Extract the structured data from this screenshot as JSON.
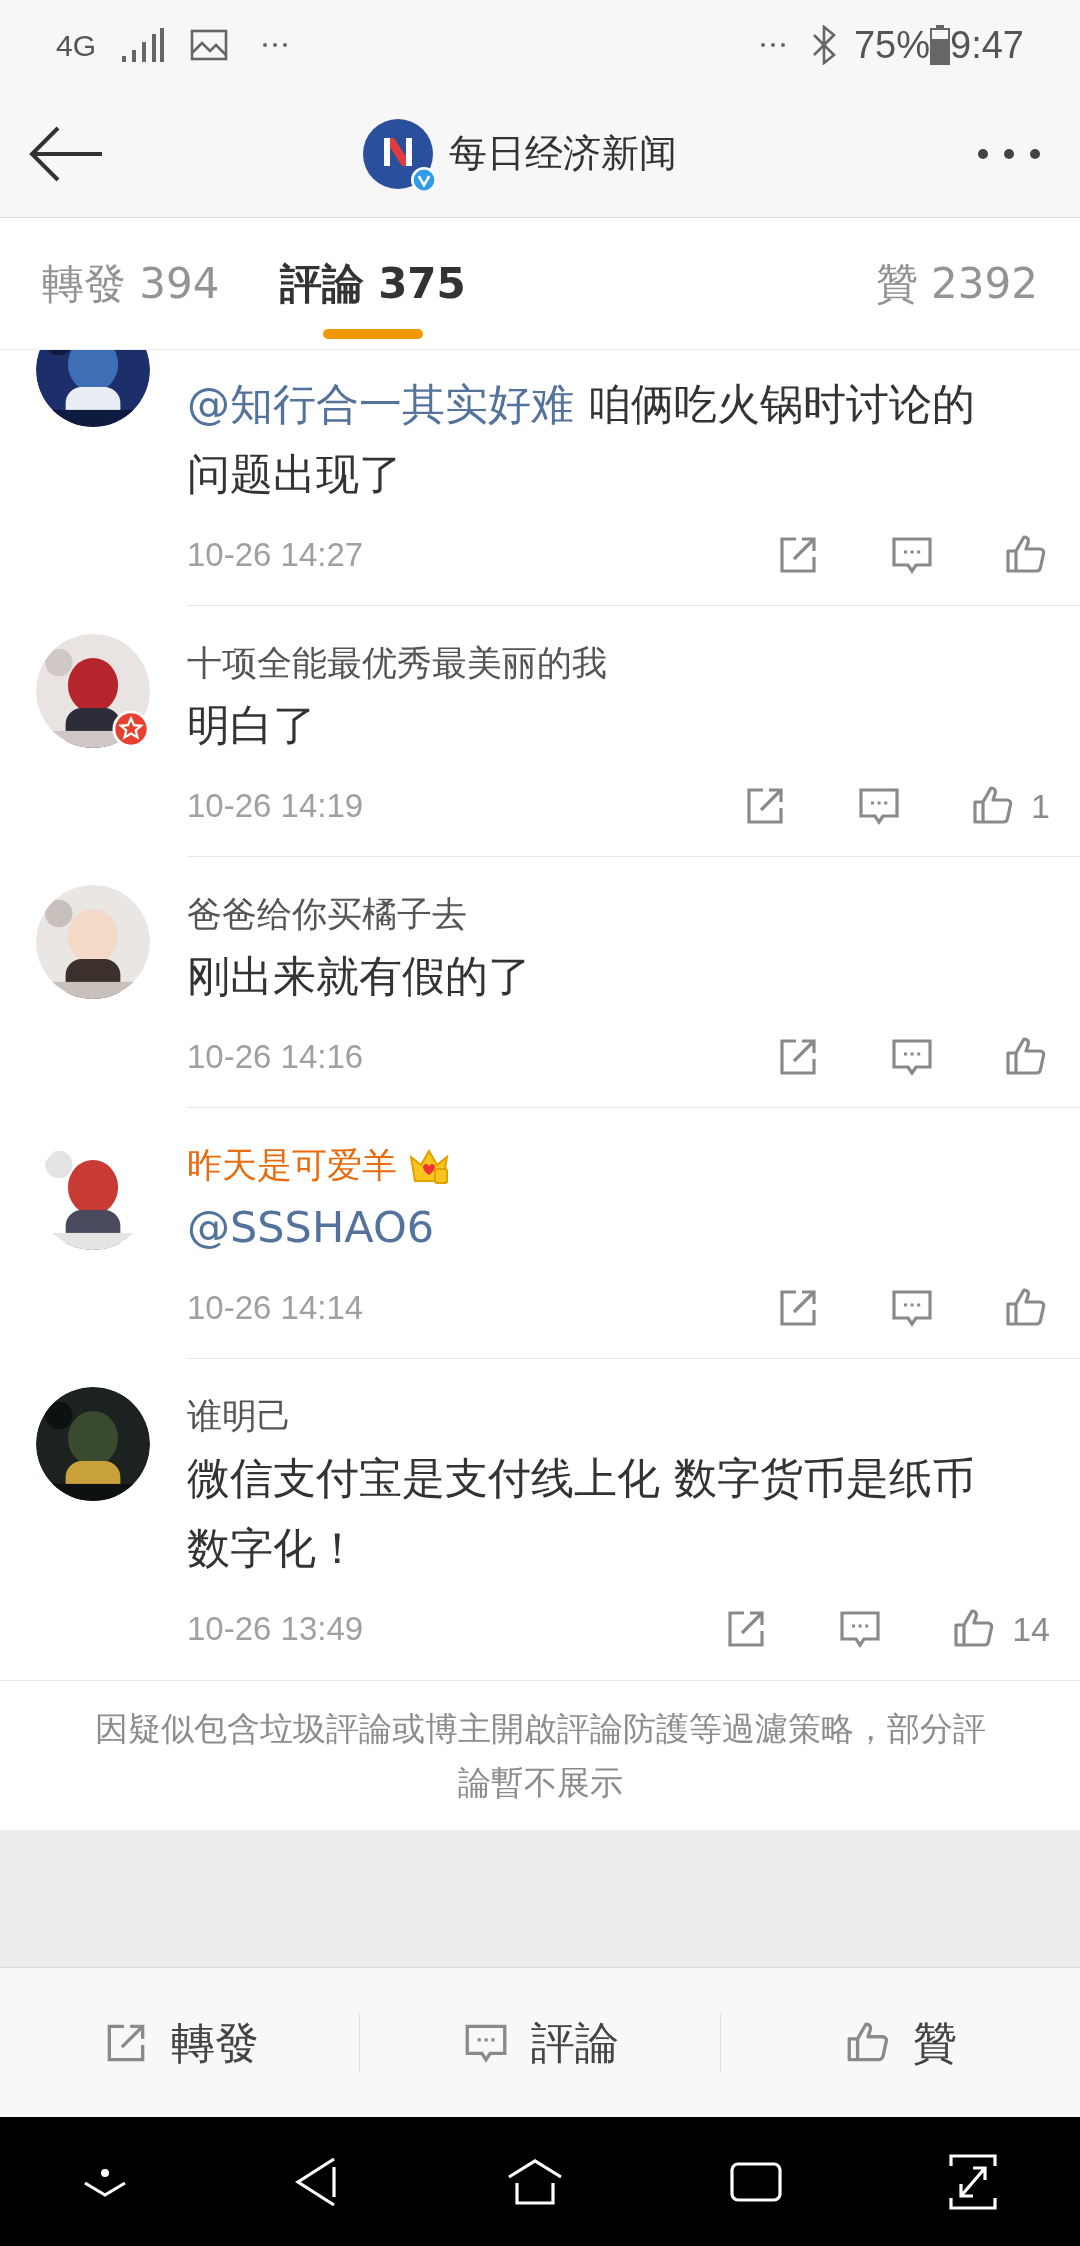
{
  "status_bar": {
    "network": "4G",
    "battery": "75%",
    "time": "9:47"
  },
  "header": {
    "title": "每日经济新闻",
    "verified": true
  },
  "tabs": [
    {
      "label": "轉發 394",
      "selected": false
    },
    {
      "label": "評論 375",
      "selected": true
    },
    {
      "label": "贊 2392",
      "selected": false
    }
  ],
  "comments": [
    {
      "vip": false,
      "badge": false,
      "content": [
        {
          "kind": "mention",
          "text": "@知行合一其实好难"
        },
        {
          "kind": "text",
          "text": " 咱俩吃火锅时讨论的问题出现了"
        }
      ],
      "time": "10-26 14:27"
    },
    {
      "name": "十项全能最优秀最美丽的我",
      "vip": false,
      "badge": true,
      "content": [
        {
          "kind": "text",
          "text": "明白了"
        }
      ],
      "time": "10-26 14:19",
      "likes": "1"
    },
    {
      "name": "爸爸给你买橘子去",
      "vip": false,
      "badge": false,
      "content": [
        {
          "kind": "text",
          "text": "刚出来就有假的了"
        }
      ],
      "time": "10-26 14:16"
    },
    {
      "name": "昨天是可爱羊",
      "vip": true,
      "badge": false,
      "content": [
        {
          "kind": "mention",
          "text": "@SSSHAO6"
        }
      ],
      "time": "10-26 14:14"
    },
    {
      "name": "谁明己",
      "vip": false,
      "badge": false,
      "content": [
        {
          "kind": "text",
          "text": "微信支付宝是支付线上化 数字货币是纸币数字化！"
        }
      ],
      "time": "10-26 13:49",
      "likes": "14"
    }
  ],
  "notice": "因疑似包含垃圾評論或博主開啟評論防護等過濾策略，部分評論暫不展示",
  "bottom_bar": [
    {
      "kind": "repost",
      "label": "轉發"
    },
    {
      "kind": "comment",
      "label": "評論"
    },
    {
      "kind": "like",
      "label": "贊"
    }
  ]
}
